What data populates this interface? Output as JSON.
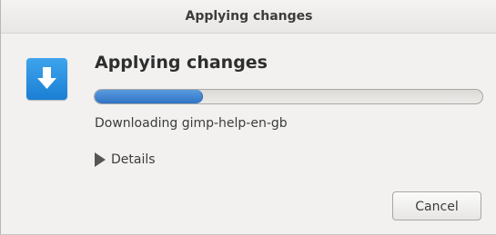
{
  "window": {
    "title": "Applying changes"
  },
  "main": {
    "icon": "download-arrow-icon",
    "heading": "Applying changes",
    "progress": 0.28,
    "status": "Downloading gimp-help-en-gb",
    "details_label": "Details"
  },
  "buttons": {
    "cancel_label": "Cancel"
  },
  "colors": {
    "accent": "#2f73c4",
    "icon_bg": "#2b8ee0"
  }
}
